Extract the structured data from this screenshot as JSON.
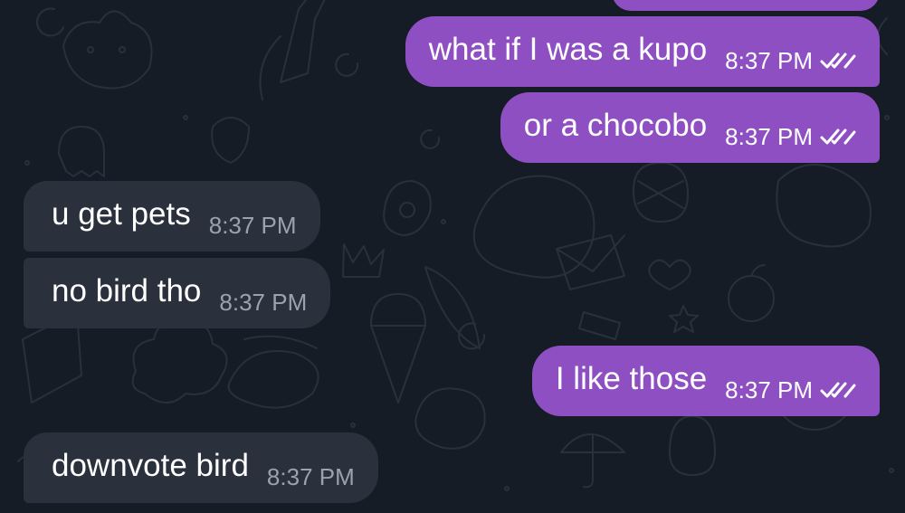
{
  "colors": {
    "background": "#151c25",
    "outgoing_bubble": "#8d4fc2",
    "incoming_bubble": "#2a313d",
    "incoming_time": "#9aa3ad"
  },
  "messages": [
    {
      "direction": "outgoing",
      "text": "what if I was a kupo",
      "time": "8:37 PM",
      "status": "read-double-check-icon"
    },
    {
      "direction": "outgoing",
      "text": "or a chocobo",
      "time": "8:37 PM",
      "status": "read-double-check-icon"
    },
    {
      "direction": "incoming",
      "text": "u get pets",
      "time": "8:37 PM"
    },
    {
      "direction": "incoming",
      "text": "no bird tho",
      "time": "8:37 PM"
    },
    {
      "direction": "outgoing",
      "text": "I like those",
      "time": "8:37 PM",
      "status": "read-double-check-icon"
    },
    {
      "direction": "incoming",
      "text": "downvote bird",
      "time": "8:37 PM"
    }
  ]
}
